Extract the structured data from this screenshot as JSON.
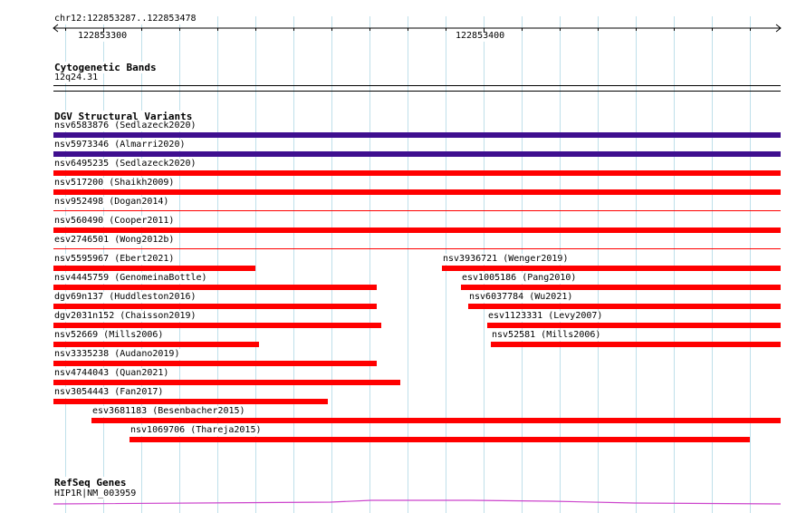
{
  "ruler": {
    "region": "chr12:122853287..122853478",
    "start": 122853287,
    "end": 122853478,
    "ticks": [
      {
        "pos": 122853300,
        "label": "122853300"
      },
      {
        "pos": 122853400,
        "label": "122853400"
      }
    ]
  },
  "cytoband": {
    "title": "Cytogenetic Bands",
    "band": "12q24.31"
  },
  "dgv": {
    "title": "DGV Structural Variants",
    "colors": {
      "gain_loss": "#3f0f8f",
      "loss": "#ff0000"
    },
    "rows": [
      [
        {
          "label": "nsv6583876 (Sedlazeck2020)",
          "start": 122853287,
          "end": 122853478,
          "color": "#3f0f8f",
          "thin": false
        }
      ],
      [
        {
          "label": "nsv5973346 (Almarri2020)",
          "start": 122853287,
          "end": 122853478,
          "color": "#3f0f8f",
          "thin": false
        }
      ],
      [
        {
          "label": "nsv6495235 (Sedlazeck2020)",
          "start": 122853287,
          "end": 122853478,
          "color": "#ff0000",
          "thin": false
        }
      ],
      [
        {
          "label": "nsv517200 (Shaikh2009)",
          "start": 122853287,
          "end": 122853478,
          "color": "#ff0000",
          "thin": false
        }
      ],
      [
        {
          "label": "nsv952498 (Dogan2014)",
          "start": 122853287,
          "end": 122853478,
          "color": "#ff0000",
          "thin": true
        }
      ],
      [
        {
          "label": "nsv560490 (Cooper2011)",
          "start": 122853287,
          "end": 122853478,
          "color": "#ff0000",
          "thin": false
        }
      ],
      [
        {
          "label": "esv2746501 (Wong2012b)",
          "start": 122853287,
          "end": 122853478,
          "color": "#ff0000",
          "thin": true
        }
      ],
      [
        {
          "label": "nsv5595967 (Ebert2021)",
          "start": 122853287,
          "end": 122853340,
          "color": "#ff0000",
          "thin": false
        },
        {
          "label": "nsv3936721 (Wenger2019)",
          "start": 122853389,
          "end": 122853478,
          "color": "#ff0000",
          "thin": false
        }
      ],
      [
        {
          "label": "nsv4445759 (GenomeinaBottle)",
          "start": 122853287,
          "end": 122853372,
          "color": "#ff0000",
          "thin": false
        },
        {
          "label": "esv1005186 (Pang2010)",
          "start": 122853394,
          "end": 122853478,
          "color": "#ff0000",
          "thin": false
        }
      ],
      [
        {
          "label": "dgv69n137 (Huddleston2016)",
          "start": 122853287,
          "end": 122853372,
          "color": "#ff0000",
          "thin": false
        },
        {
          "label": "nsv6037784 (Wu2021)",
          "start": 122853396,
          "end": 122853478,
          "color": "#ff0000",
          "thin": false
        }
      ],
      [
        {
          "label": "dgv2031n152 (Chaisson2019)",
          "start": 122853287,
          "end": 122853373,
          "color": "#ff0000",
          "thin": false
        },
        {
          "label": "esv1123331 (Levy2007)",
          "start": 122853401,
          "end": 122853478,
          "color": "#ff0000",
          "thin": false
        }
      ],
      [
        {
          "label": "nsv52669 (Mills2006)",
          "start": 122853287,
          "end": 122853341,
          "color": "#ff0000",
          "thin": false
        },
        {
          "label": "nsv52581 (Mills2006)",
          "start": 122853402,
          "end": 122853478,
          "color": "#ff0000",
          "thin": false
        }
      ],
      [
        {
          "label": "nsv3335238 (Audano2019)",
          "start": 122853287,
          "end": 122853372,
          "color": "#ff0000",
          "thin": false
        }
      ],
      [
        {
          "label": "nsv4744043 (Quan2021)",
          "start": 122853287,
          "end": 122853378,
          "color": "#ff0000",
          "thin": false
        }
      ],
      [
        {
          "label": "nsv3054443 (Fan2017)",
          "start": 122853287,
          "end": 122853359,
          "color": "#ff0000",
          "thin": false
        }
      ],
      [
        {
          "label": "esv3681183 (Besenbacher2015)",
          "start": 122853297,
          "end": 122853478,
          "color": "#ff0000",
          "thin": false
        }
      ],
      [
        {
          "label": "nsv1069706 (Thareja2015)",
          "start": 122853307,
          "end": 122853470,
          "color": "#ff0000",
          "thin": false
        }
      ]
    ]
  },
  "refseq": {
    "title": "RefSeq Genes",
    "gene": "HIP1R|NM_003959",
    "color": "#cc44cc"
  }
}
